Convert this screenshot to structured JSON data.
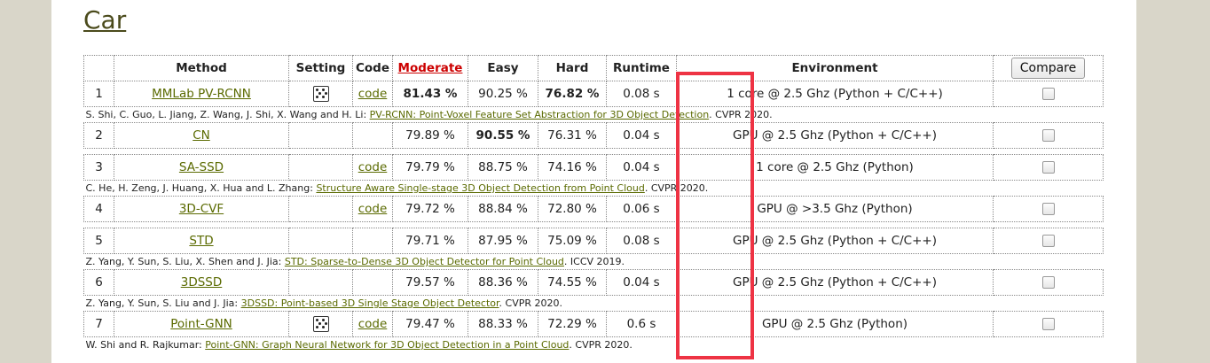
{
  "section_title": "Car",
  "headers": {
    "method": "Method",
    "setting": "Setting",
    "code": "Code",
    "moderate": "Moderate",
    "easy": "Easy",
    "hard": "Hard",
    "runtime": "Runtime",
    "environment": "Environment",
    "compare": "Compare"
  },
  "rows": [
    {
      "rank": "1",
      "method": "MMLab PV-RCNN",
      "setting": true,
      "code": "code",
      "moderate": "81.43 %",
      "easy": "90.25 %",
      "hard": "76.82 %",
      "runtime": "0.08 s",
      "environment": "1 core @ 2.5 Ghz (Python + C/C++)",
      "ref": {
        "authors": "S. Shi, C. Guo, L. Jiang, Z. Wang, J. Shi, X. Wang and H. Li: ",
        "title": "PV-RCNN: Point-Voxel Feature Set Abstraction for 3D Object Detection",
        "venue": ". CVPR 2020."
      }
    },
    {
      "rank": "2",
      "method": "CN",
      "setting": false,
      "code": "",
      "moderate": "79.89 %",
      "easy": "90.55 %",
      "hard": "76.31 %",
      "runtime": "0.04 s",
      "environment": "GPU @ 2.5 Ghz (Python + C/C++)",
      "ref": null
    },
    {
      "rank": "3",
      "method": "SA-SSD",
      "setting": false,
      "code": "code",
      "moderate": "79.79 %",
      "easy": "88.75 %",
      "hard": "74.16 %",
      "runtime": "0.04 s",
      "environment": "1 core @ 2.5 Ghz (Python)",
      "ref": {
        "authors": "C. He, H. Zeng, J. Huang, X. Hua and L. Zhang: ",
        "title": "Structure Aware Single-stage 3D Object Detection from Point Cloud",
        "venue": ". CVPR 2020."
      }
    },
    {
      "rank": "4",
      "method": "3D-CVF",
      "setting": false,
      "code": "code",
      "moderate": "79.72 %",
      "easy": "88.84 %",
      "hard": "72.80 %",
      "runtime": "0.06 s",
      "environment": "GPU @ >3.5 Ghz (Python)",
      "ref": null
    },
    {
      "rank": "5",
      "method": "STD",
      "setting": false,
      "code": "",
      "moderate": "79.71 %",
      "easy": "87.95 %",
      "hard": "75.09 %",
      "runtime": "0.08 s",
      "environment": "GPU @ 2.5 Ghz (Python + C/C++)",
      "ref": {
        "authors": "Z. Yang, Y. Sun, S. Liu, X. Shen and J. Jia: ",
        "title": "STD: Sparse-to-Dense 3D Object Detector for Point Cloud",
        "venue": ". ICCV 2019."
      }
    },
    {
      "rank": "6",
      "method": "3DSSD",
      "setting": false,
      "code": "",
      "moderate": "79.57 %",
      "easy": "88.36 %",
      "hard": "74.55 %",
      "runtime": "0.04 s",
      "environment": "GPU @ 2.5 Ghz (Python + C/C++)",
      "ref": {
        "authors": "Z. Yang, Y. Sun, S. Liu and J. Jia: ",
        "title": "3DSSD: Point-based 3D Single Stage Object Detector",
        "venue": ". CVPR 2020."
      }
    },
    {
      "rank": "7",
      "method": "Point-GNN",
      "setting": true,
      "code": "code",
      "moderate": "79.47 %",
      "easy": "88.33 %",
      "hard": "72.29 %",
      "runtime": "0.6 s",
      "environment": "GPU @ 2.5 Ghz (Python)",
      "ref": {
        "authors": "W. Shi and R. Rajkumar: ",
        "title": "Point-GNN: Graph Neural Network for 3D Object Detection in a Point Cloud",
        "venue": ". CVPR 2020."
      }
    }
  ],
  "bold_cells": [
    [
      "0",
      "moderate"
    ],
    [
      "0",
      "hard"
    ],
    [
      "1",
      "easy"
    ]
  ],
  "colors": {
    "link": "#5a6a00",
    "sort_link": "#cc0000",
    "highlight": "#ee3344"
  }
}
